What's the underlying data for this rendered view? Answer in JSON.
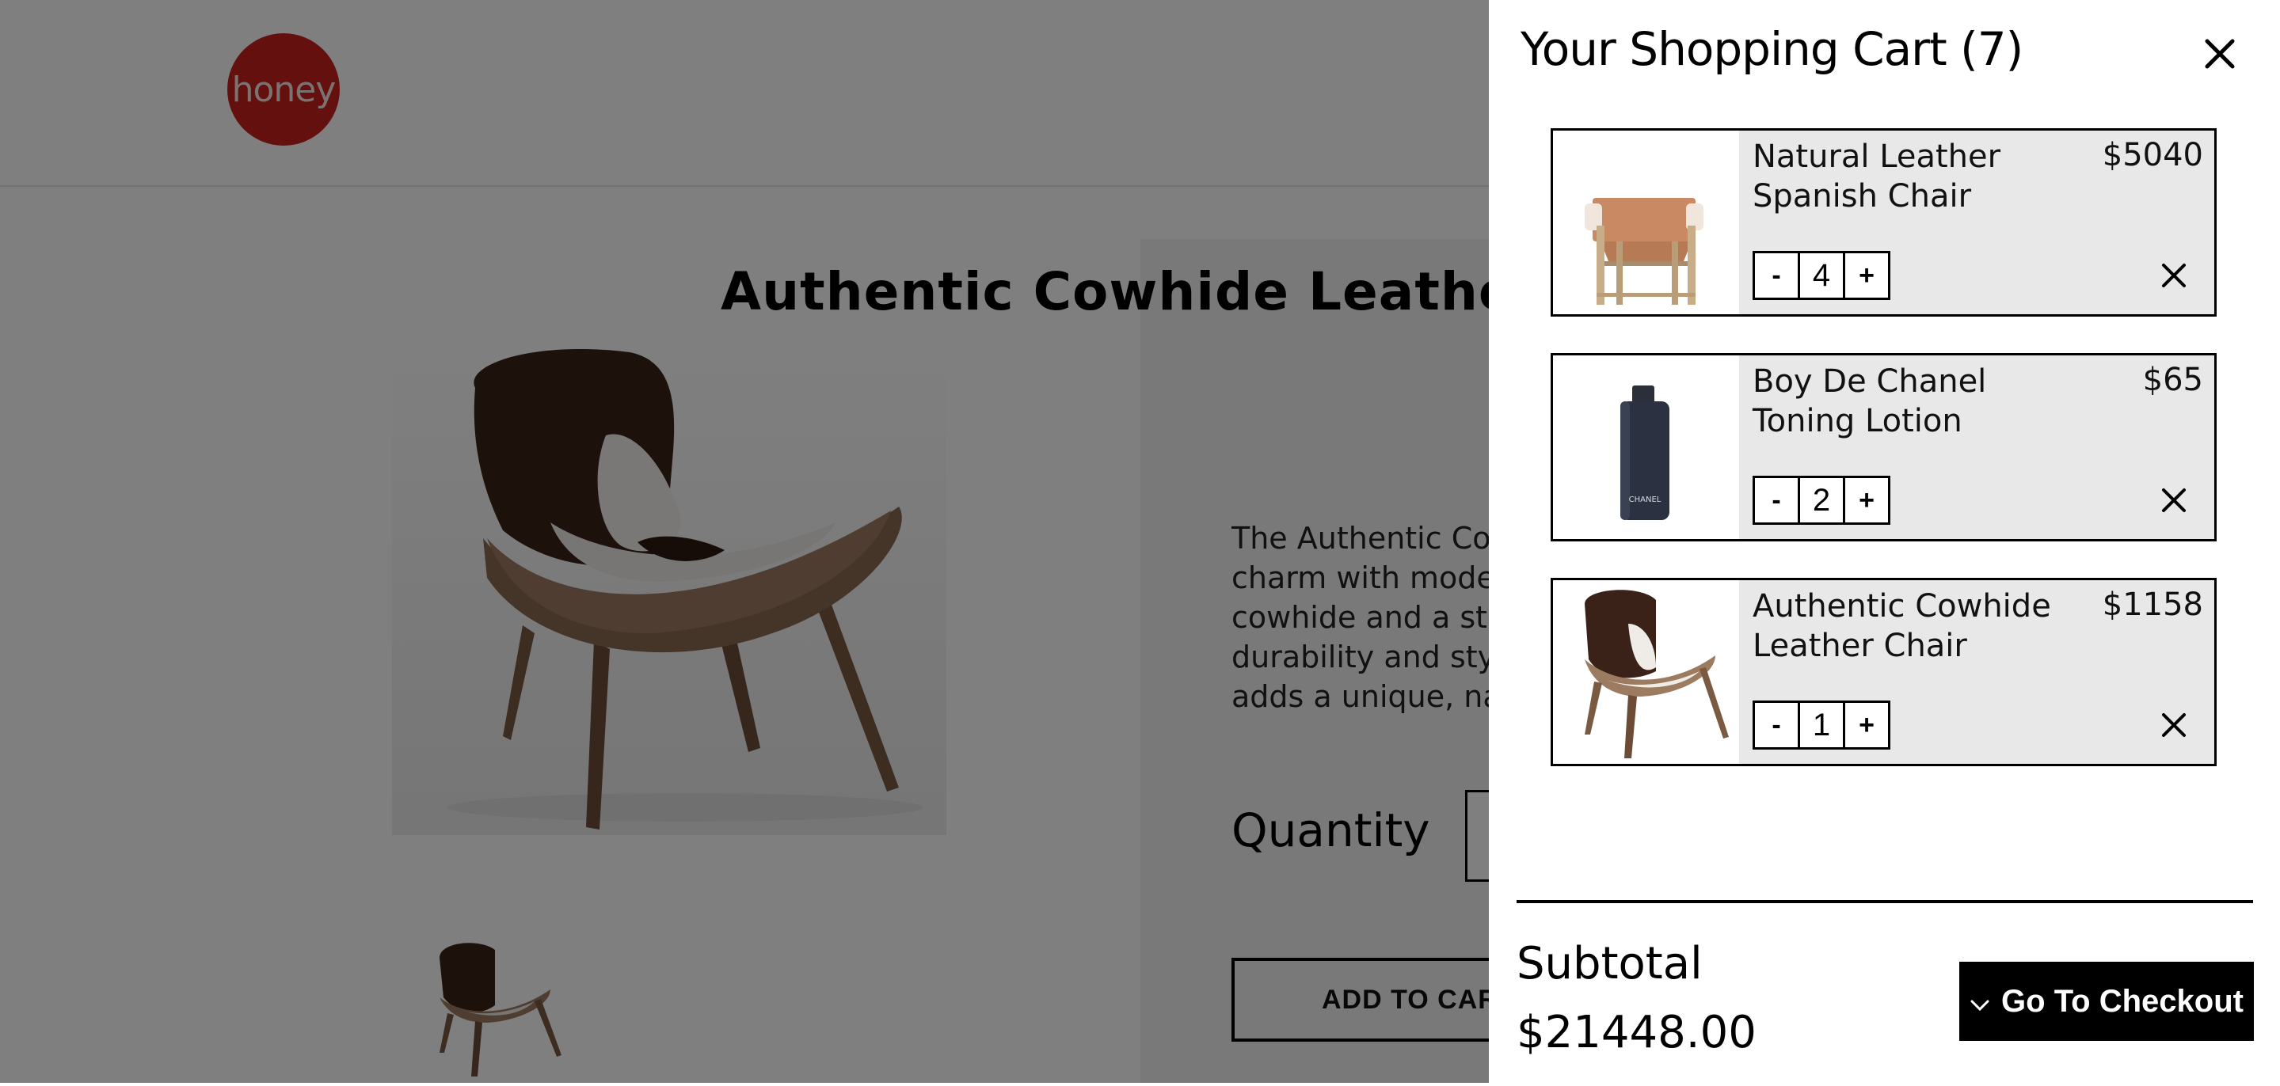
{
  "header": {
    "logo_text": "honey"
  },
  "product": {
    "title": "Authentic Cowhide Leather Ch",
    "description_lines": [
      "The Authentic Cowh",
      "charm with modern",
      "cowhide and a sturd",
      "durability and style.",
      "adds a unique, natu"
    ],
    "quantity_label": "Quantity",
    "add_to_cart_label": "ADD TO CART"
  },
  "cart": {
    "title": "Your Shopping Cart (7)",
    "close_icon": "close-icon",
    "items": [
      {
        "name": "Natural Leather Spanish Chair",
        "price": "$5040",
        "quantity": "4",
        "minus_label": "-",
        "plus_label": "+",
        "remove_icon": "close-icon"
      },
      {
        "name": "Boy De Chanel Toning Lotion",
        "price": "$65",
        "quantity": "2",
        "minus_label": "-",
        "plus_label": "+",
        "remove_icon": "close-icon",
        "bottle_text": "CHANEL"
      },
      {
        "name": "Authentic Cowhide Leather Chair",
        "price": "$1158",
        "quantity": "1",
        "minus_label": "-",
        "plus_label": "+",
        "remove_icon": "close-icon"
      }
    ],
    "subtotal_label": "Subtotal",
    "subtotal_value": "$21448.00",
    "checkout_label": "Go To Checkout",
    "checkout_icon": "chevron-down-icon"
  },
  "colors": {
    "logo": "#c8211c",
    "overlay": "rgba(0,0,0,0.5)",
    "item_bg": "#e8e8e8",
    "checkout_bg": "#000000"
  }
}
